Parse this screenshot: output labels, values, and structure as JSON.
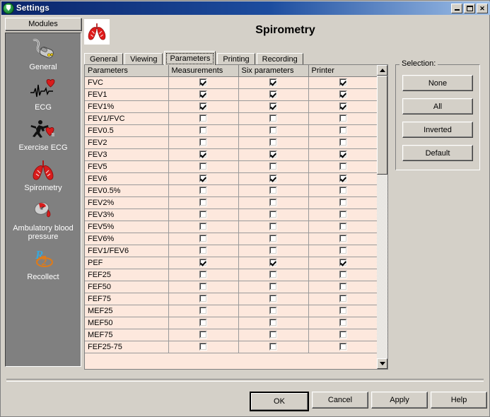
{
  "window": {
    "title": "Settings",
    "icon": "shield-icon",
    "controls": {
      "minimize": "minimize-icon",
      "maximize": "maximize-icon",
      "close": "close-icon"
    }
  },
  "sidebar": {
    "header": "Modules",
    "items": [
      {
        "label": "General",
        "icon": "mouse-icon"
      },
      {
        "label": "ECG",
        "icon": "ecg-heart-icon"
      },
      {
        "label": "Exercise ECG",
        "icon": "runner-heart-icon"
      },
      {
        "label": "Spirometry",
        "icon": "lungs-icon"
      },
      {
        "label": "Ambulatory blood pressure",
        "icon": "blood-pressure-cuff-icon"
      },
      {
        "label": "Recollect",
        "icon": "recollect-logo-icon"
      }
    ],
    "selected": "Spirometry"
  },
  "main": {
    "page_title": "Spirometry",
    "page_icon": "lungs-icon",
    "tabs": [
      {
        "label": "General",
        "active": false
      },
      {
        "label": "Viewing",
        "active": false
      },
      {
        "label": "Parameters",
        "active": true
      },
      {
        "label": "Printing",
        "active": false
      },
      {
        "label": "Recording",
        "active": false
      }
    ]
  },
  "table": {
    "columns": [
      "Parameters",
      "Measurements",
      "Six parameters",
      "Printer"
    ],
    "rows": [
      {
        "name": "FVC",
        "measurements": true,
        "six": true,
        "printer": true
      },
      {
        "name": "FEV1",
        "measurements": true,
        "six": true,
        "printer": true
      },
      {
        "name": "FEV1%",
        "measurements": true,
        "six": true,
        "printer": true
      },
      {
        "name": "FEV1/FVC",
        "measurements": false,
        "six": false,
        "printer": false
      },
      {
        "name": "FEV0.5",
        "measurements": false,
        "six": false,
        "printer": false
      },
      {
        "name": "FEV2",
        "measurements": false,
        "six": false,
        "printer": false
      },
      {
        "name": "FEV3",
        "measurements": true,
        "six": true,
        "printer": true
      },
      {
        "name": "FEV5",
        "measurements": false,
        "six": false,
        "printer": false
      },
      {
        "name": "FEV6",
        "measurements": true,
        "six": true,
        "printer": true
      },
      {
        "name": "FEV0.5%",
        "measurements": false,
        "six": false,
        "printer": false
      },
      {
        "name": "FEV2%",
        "measurements": false,
        "six": false,
        "printer": false
      },
      {
        "name": "FEV3%",
        "measurements": false,
        "six": false,
        "printer": false
      },
      {
        "name": "FEV5%",
        "measurements": false,
        "six": false,
        "printer": false
      },
      {
        "name": "FEV6%",
        "measurements": false,
        "six": false,
        "printer": false
      },
      {
        "name": "FEV1/FEV6",
        "measurements": false,
        "six": false,
        "printer": false
      },
      {
        "name": "PEF",
        "measurements": true,
        "six": true,
        "printer": true
      },
      {
        "name": "FEF25",
        "measurements": false,
        "six": false,
        "printer": false
      },
      {
        "name": "FEF50",
        "measurements": false,
        "six": false,
        "printer": false
      },
      {
        "name": "FEF75",
        "measurements": false,
        "six": false,
        "printer": false
      },
      {
        "name": "MEF25",
        "measurements": false,
        "six": false,
        "printer": false
      },
      {
        "name": "MEF50",
        "measurements": false,
        "six": false,
        "printer": false
      },
      {
        "name": "MEF75",
        "measurements": false,
        "six": false,
        "printer": false
      },
      {
        "name": "FEF25-75",
        "measurements": false,
        "six": false,
        "printer": false
      }
    ]
  },
  "scrollbar": {
    "up_arrow": "arrow-up-icon",
    "down_arrow": "arrow-down-icon"
  },
  "selection": {
    "legend": "Selection:",
    "buttons": [
      "None",
      "All",
      "Inverted",
      "Default"
    ]
  },
  "footer": {
    "buttons": [
      {
        "label": "OK",
        "default": true
      },
      {
        "label": "Cancel",
        "default": false
      },
      {
        "label": "Apply",
        "default": false
      },
      {
        "label": "Help",
        "default": false
      }
    ]
  },
  "colors": {
    "window_face": "#d4d0c8",
    "title_start": "#0a246a",
    "title_end": "#9fc0e8",
    "grid_row": "#fde8dd",
    "sidebar": "#808080",
    "accent_red": "#cc1111"
  }
}
